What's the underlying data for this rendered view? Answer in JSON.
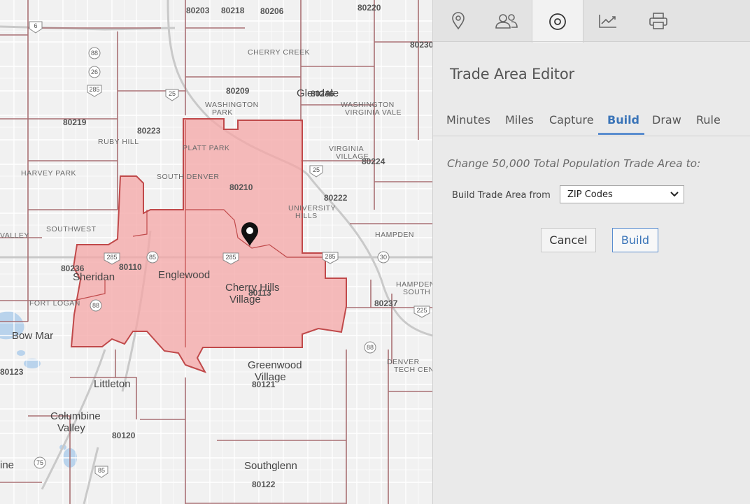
{
  "map": {
    "zip_labels": [
      "80203",
      "80218",
      "80206",
      "80220",
      "80209",
      "80246",
      "80219",
      "80223",
      "80224",
      "80210",
      "80222",
      "80236",
      "80110",
      "80113",
      "80237",
      "80121",
      "80120",
      "80122",
      "80123",
      "80230"
    ],
    "area_labels": [
      "CHERRY CREEK",
      "WASHINGTON PARK",
      "WASHINGTON VIRGINIA VALE",
      "RUBY HILL",
      "HARVEY PARK",
      "SOUTH DENVER",
      "PLATT PARK",
      "VIRGINIA VILLAGE",
      "UNIVERSITY HILLS",
      "SOUTHWEST",
      "HAMPDEN",
      "HAMPDEN SOUTH",
      "FORT LOGAN",
      "DENVER TECH CENT",
      "VALLEY"
    ],
    "town_labels": [
      "Glendale",
      "Englewood",
      "Sheridan",
      "Cherry Hills Village",
      "Bow Mar",
      "Littleton",
      "Greenwood Village",
      "Columbine Valley",
      "Southglenn",
      "ine"
    ],
    "highway_shields": [
      "6",
      "88",
      "26",
      "285",
      "25",
      "85",
      "30",
      "225",
      "88",
      "75",
      "85",
      "285"
    ],
    "trade_area_fill": "#f4a6a6",
    "trade_area_stroke": "#c0494a",
    "marker_icon": "map-pin-icon"
  },
  "panel": {
    "icon_tabs": [
      {
        "icon": "location-pin-icon",
        "active": false
      },
      {
        "icon": "people-icon",
        "active": false
      },
      {
        "icon": "target-icon",
        "active": true
      },
      {
        "icon": "trend-chart-icon",
        "active": false
      },
      {
        "icon": "printer-icon",
        "active": false
      }
    ],
    "title": "Trade Area Editor",
    "tabs": [
      "Minutes",
      "Miles",
      "Capture",
      "Build",
      "Draw",
      "Rule"
    ],
    "active_tab": "Build",
    "subtitle": "Change 50,000 Total Population Trade Area to:",
    "build_from_label": "Build Trade Area from",
    "build_from_value": "ZIP Codes",
    "cancel_label": "Cancel",
    "build_label": "Build",
    "accent_color": "#3a74b8"
  }
}
